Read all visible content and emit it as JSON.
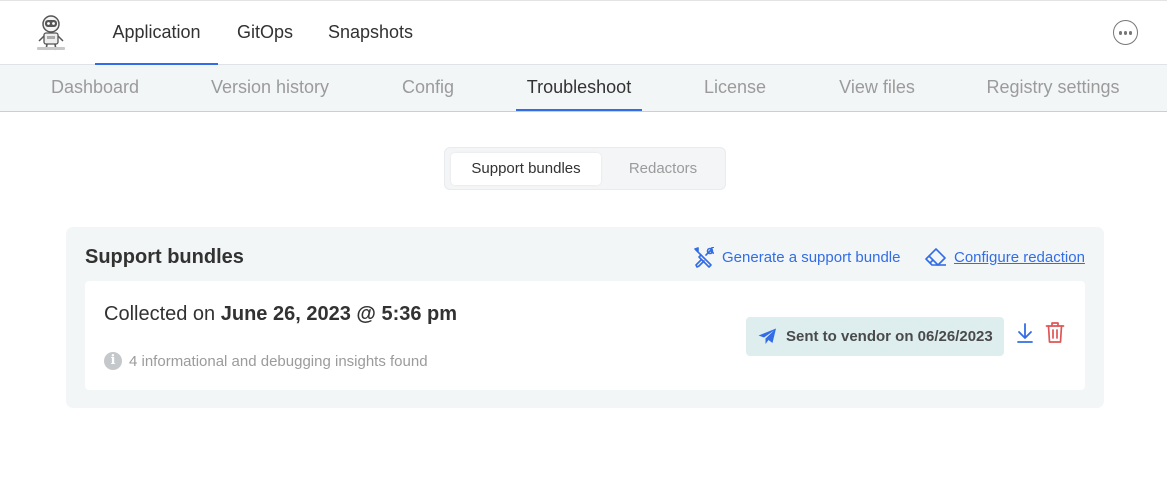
{
  "topnav": {
    "logo_icon": "robot-logo-icon",
    "tabs": [
      {
        "label": "Application",
        "active": true
      },
      {
        "label": "GitOps",
        "active": false
      },
      {
        "label": "Snapshots",
        "active": false
      }
    ],
    "more_icon": "more-options-icon"
  },
  "subnav": {
    "tabs": [
      {
        "label": "Dashboard",
        "active": false
      },
      {
        "label": "Version history",
        "active": false
      },
      {
        "label": "Config",
        "active": false
      },
      {
        "label": "Troubleshoot",
        "active": true
      },
      {
        "label": "License",
        "active": false
      },
      {
        "label": "View files",
        "active": false
      },
      {
        "label": "Registry settings",
        "active": false
      }
    ]
  },
  "toggle": {
    "options": [
      {
        "label": "Support bundles",
        "selected": true
      },
      {
        "label": "Redactors",
        "selected": false
      }
    ]
  },
  "support_bundles": {
    "title": "Support bundles",
    "generate_label": "Generate a support bundle",
    "generate_icon": "tools-icon",
    "configure_label": "Configure redaction",
    "configure_icon": "eraser-icon",
    "bundle": {
      "collected_prefix": "Collected on",
      "collected_date": "June 26, 2023 @ 5:36 pm",
      "insights_text": "4 informational and debugging insights found",
      "insights_icon": "info-icon",
      "sent_label": "Sent to vendor on 06/26/2023",
      "sent_icon": "paper-plane-icon",
      "download_icon": "download-icon",
      "delete_icon": "trash-icon"
    }
  },
  "colors": {
    "accent": "#326de6",
    "danger": "#e05555",
    "badge_bg": "#deeeef",
    "card_bg": "#f3f6f7"
  }
}
